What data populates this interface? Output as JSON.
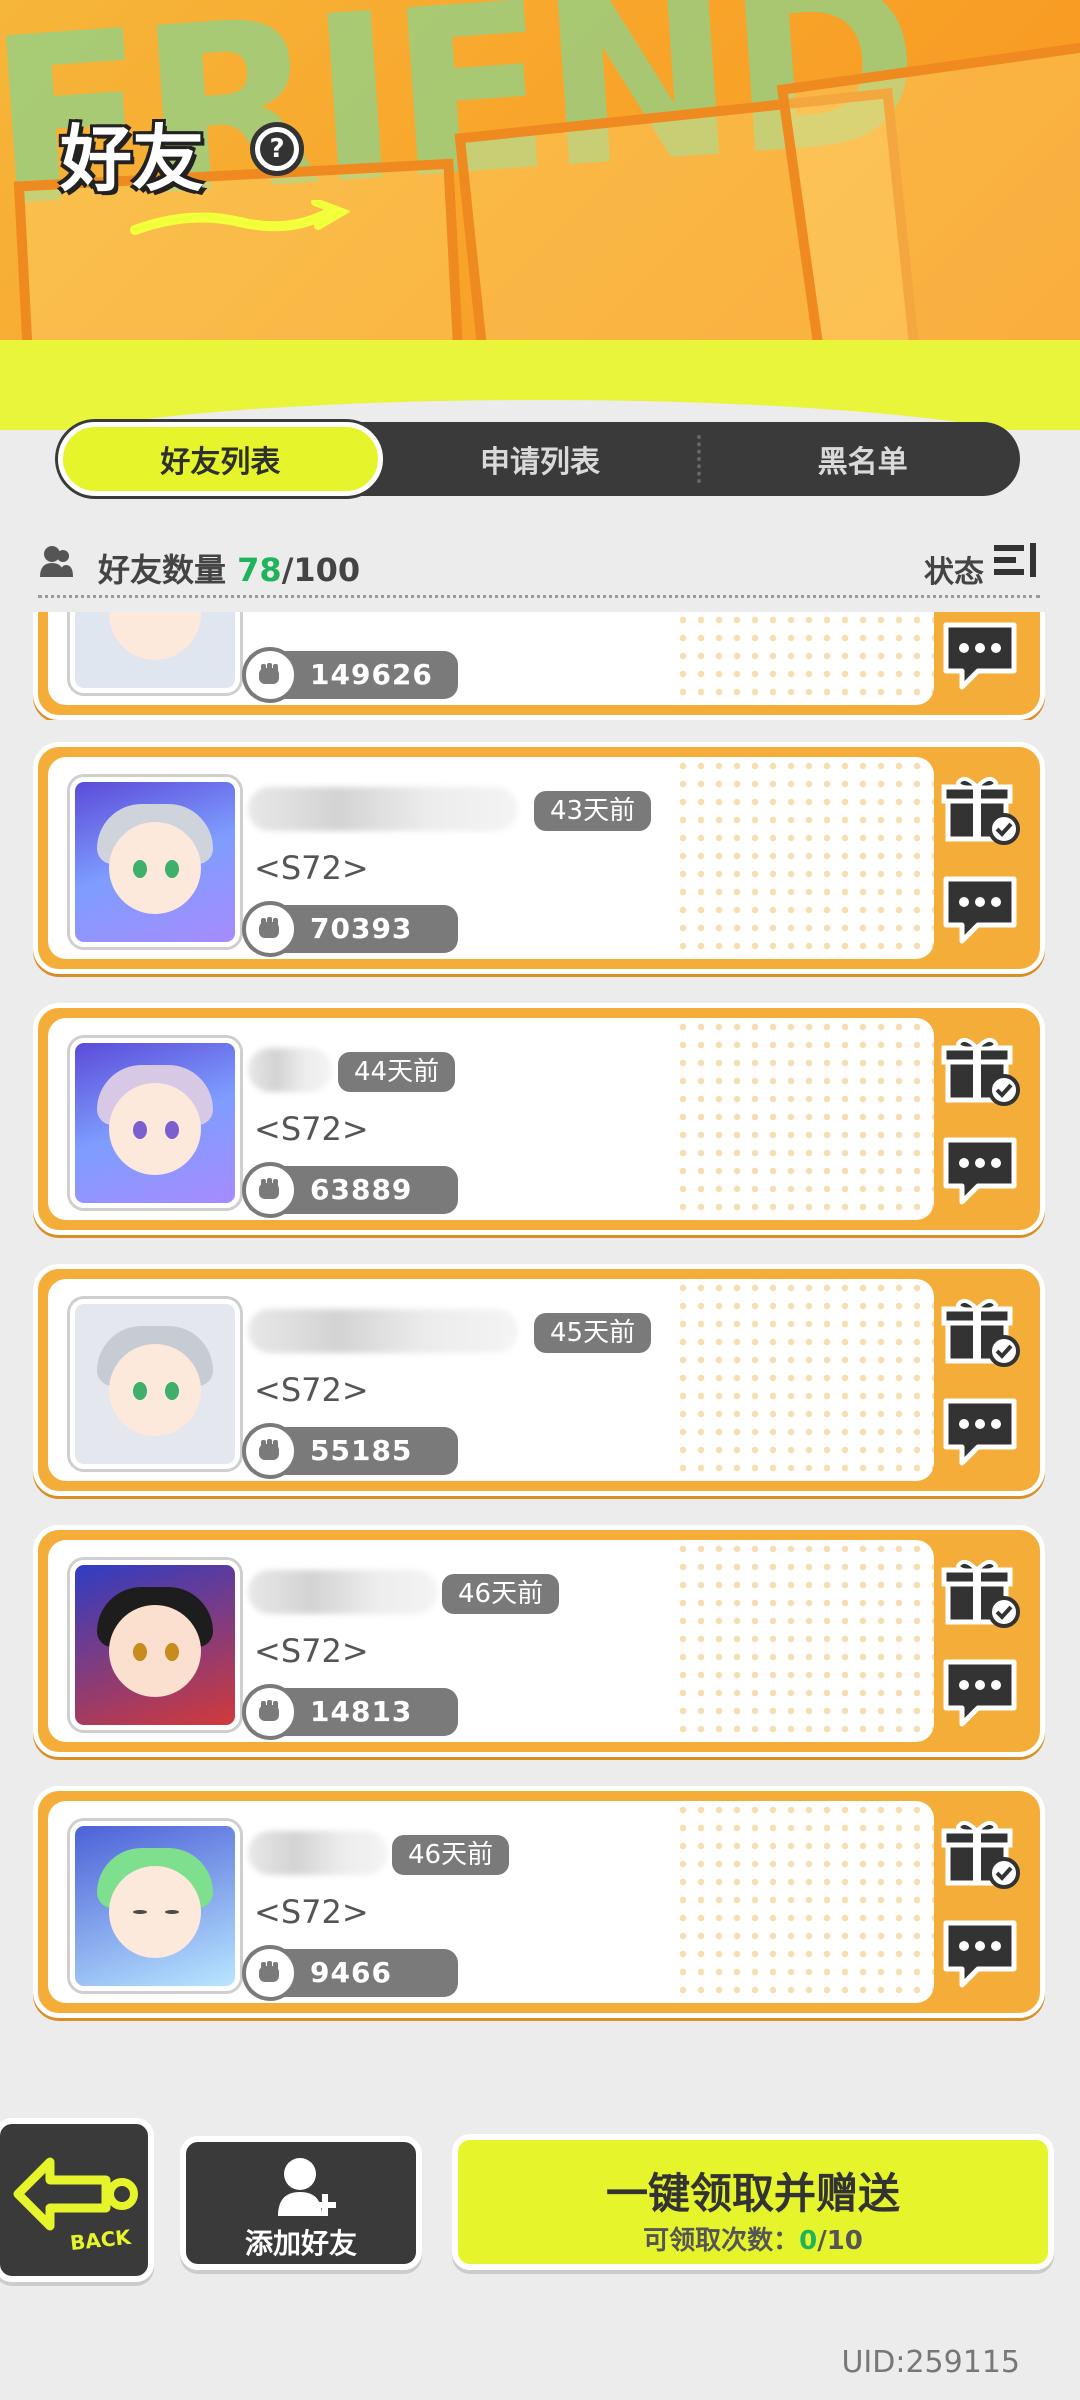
{
  "header": {
    "bg_text": "FRIEND",
    "title": "好友",
    "help_icon": "question-icon",
    "help_glyph": "?"
  },
  "tabs": [
    {
      "label": "好友列表",
      "active": true
    },
    {
      "label": "申请列表",
      "active": false
    },
    {
      "label": "黑名单",
      "active": false
    }
  ],
  "count_bar": {
    "label": "好友数量",
    "current": "78",
    "separator": "/",
    "max": "100",
    "status_label": "状态"
  },
  "friends": [
    {
      "days_ago": "",
      "server": "",
      "power": "149626"
    },
    {
      "days_ago": "43天前",
      "server": "<S72>",
      "power": "70393"
    },
    {
      "days_ago": "44天前",
      "server": "<S72>",
      "power": "63889"
    },
    {
      "days_ago": "45天前",
      "server": "<S72>",
      "power": "55185"
    },
    {
      "days_ago": "46天前",
      "server": "<S72>",
      "power": "14813"
    },
    {
      "days_ago": "46天前",
      "server": "<S72>",
      "power": "9466"
    }
  ],
  "bottom": {
    "back_label": "BACK",
    "add_friend_label": "添加好友",
    "claim_title": "一键领取并赠送",
    "claim_sub_label": "可领取次数：",
    "claim_current": "0",
    "claim_max": "/10",
    "uid": "UID:259115"
  },
  "colors": {
    "accent_yellow": "#e6f52b",
    "card_orange": "#f5ad3a",
    "count_green": "#1fb35a",
    "dark": "#3a3a3a"
  }
}
